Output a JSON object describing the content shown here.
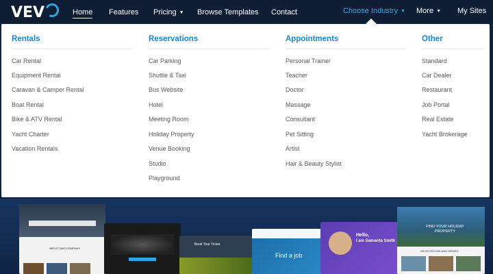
{
  "logo": {
    "text": "VEV"
  },
  "nav": {
    "home": "Home",
    "features": "Features",
    "pricing": "Pricing",
    "browse_templates": "Browse Templates",
    "contact": "Contact",
    "choose_industry": "Choose Industry",
    "more": "More",
    "my_sites": "My Sites"
  },
  "dropdown": {
    "columns": [
      {
        "title": "Rentals",
        "items": [
          "Car Rental",
          "Equipment Rental",
          "Caravan & Camper Rental",
          "Boat Rental",
          "Bike & ATV Rental",
          "Yacht Charter",
          "Vacation Rentals"
        ]
      },
      {
        "title": "Reservations",
        "items": [
          "Car Parking",
          "Shuttle & Taxi",
          "Bus Website",
          "Hotel",
          "Meeting Room",
          "Holiday Property",
          "Venue Booking",
          "Studio",
          "Playground"
        ]
      },
      {
        "title": "Appointments",
        "items": [
          "Personal Trainer",
          "Teacher",
          "Doctor",
          "Massage",
          "Consultant",
          "Pet Sitting",
          "Artist",
          "Hair & Beauty Stylist"
        ]
      },
      {
        "title": "Other",
        "items": [
          "Standard",
          "Car Dealer",
          "Restaurant",
          "Job Portal",
          "Real Estate",
          "Yacht Brokerage"
        ]
      }
    ]
  },
  "hero": {
    "shot_find_job": "Find a job",
    "shot_hello": "Hello,",
    "shot_name": "I am Samanta Smith",
    "shot_holiday": "FIND YOUR HOLIDAY PROPERTY",
    "shot_selected": "SELECTED HOLIDAY HOMES",
    "shot_about": "ABOUT OUR COMPANY",
    "shot_book": "Book Your Ticket"
  },
  "colors": {
    "nav_bg": "#0f1e35",
    "accent": "#1a86c8",
    "industry": "#2aa7e8",
    "link": "#555a62"
  }
}
